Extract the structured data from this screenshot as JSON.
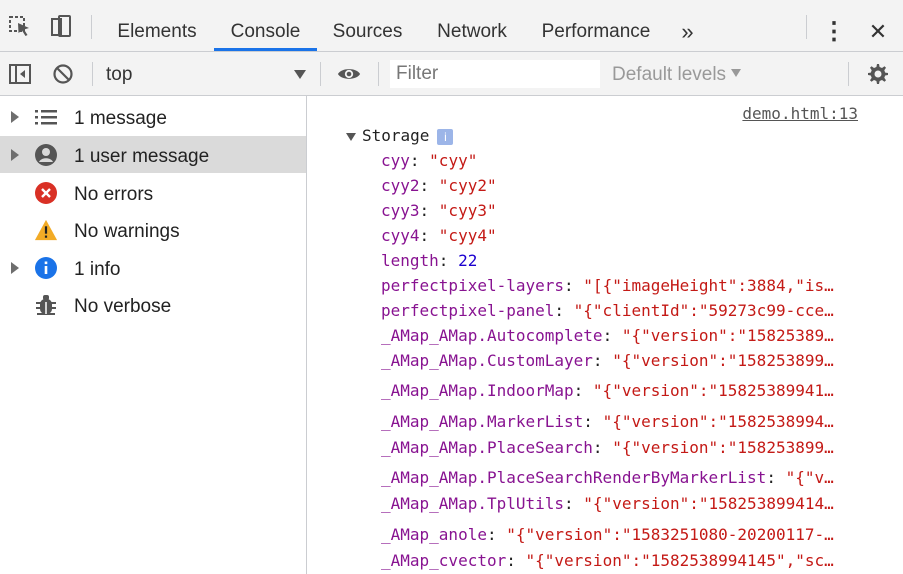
{
  "tabs": [
    {
      "label": "Elements",
      "active": false
    },
    {
      "label": "Console",
      "active": true
    },
    {
      "label": "Sources",
      "active": false
    },
    {
      "label": "Network",
      "active": false
    },
    {
      "label": "Performance",
      "active": false
    }
  ],
  "tabbar": {
    "overflow_glyph": "»",
    "menu_glyph": "⋮",
    "close_glyph": "✕"
  },
  "toolbar": {
    "context": "top",
    "filter_placeholder": "Filter",
    "levels": "Default levels"
  },
  "sidebar": {
    "items": [
      {
        "label": "1 message",
        "icon": "list-icon",
        "expandable": true
      },
      {
        "label": "1 user message",
        "icon": "user-icon",
        "expandable": true,
        "selected": true
      },
      {
        "label": "No errors",
        "icon": "error-icon",
        "expandable": false
      },
      {
        "label": "No warnings",
        "icon": "warning-icon",
        "expandable": false
      },
      {
        "label": "1 info",
        "icon": "info-icon",
        "expandable": true
      },
      {
        "label": "No verbose",
        "icon": "bug-icon",
        "expandable": false
      }
    ]
  },
  "console": {
    "source": "demo.html:13",
    "object_name": "Storage",
    "info_badge": "i",
    "properties": [
      {
        "key": "cyy",
        "value": "\"cyy\"",
        "type": "string"
      },
      {
        "key": "cyy2",
        "value": "\"cyy2\"",
        "type": "string"
      },
      {
        "key": "cyy3",
        "value": "\"cyy3\"",
        "type": "string"
      },
      {
        "key": "cyy4",
        "value": "\"cyy4\"",
        "type": "string"
      },
      {
        "key": "length",
        "value": "22",
        "type": "number"
      },
      {
        "key": "perfectpixel-layers",
        "value": "\"[{\"imageHeight\":3884,\"is…",
        "type": "string"
      },
      {
        "key": "perfectpixel-panel",
        "value": "\"{\"clientId\":\"59273c99-cce…",
        "type": "string"
      },
      {
        "key": "_AMap_AMap.Autocomplete",
        "value": "\"{\"version\":\"15825389…",
        "type": "string"
      },
      {
        "key": "_AMap_AMap.CustomLayer",
        "value": "\"{\"version\":\"158253899…",
        "type": "string"
      },
      {
        "key": "_AMap_AMap.IndoorMap",
        "value": "\"{\"version\":\"15825389941…",
        "type": "string"
      },
      {
        "key": "_AMap_AMap.MarkerList",
        "value": "\"{\"version\":\"1582538994…",
        "type": "string"
      },
      {
        "key": "_AMap_AMap.PlaceSearch",
        "value": "\"{\"version\":\"158253899…",
        "type": "string"
      },
      {
        "key": "_AMap_AMap.PlaceSearchRenderByMarkerList",
        "value": "\"{\"v…",
        "type": "string"
      },
      {
        "key": "_AMap_AMap.TplUtils",
        "value": "\"{\"version\":\"158253899414…",
        "type": "string"
      },
      {
        "key": "_AMap_anole",
        "value": "\"{\"version\":\"1583251080-20200117-…",
        "type": "string"
      },
      {
        "key": "_AMap_cvector",
        "value": "\"{\"version\":\"1582538994145\",\"sc…",
        "type": "string"
      }
    ]
  },
  "colors": {
    "accent": "#1a73e8",
    "key": "#881391",
    "string": "#c41a16",
    "number": "#1c00cf",
    "error": "#d93025",
    "warning": "#f2ab26",
    "info": "#1a73e8"
  }
}
